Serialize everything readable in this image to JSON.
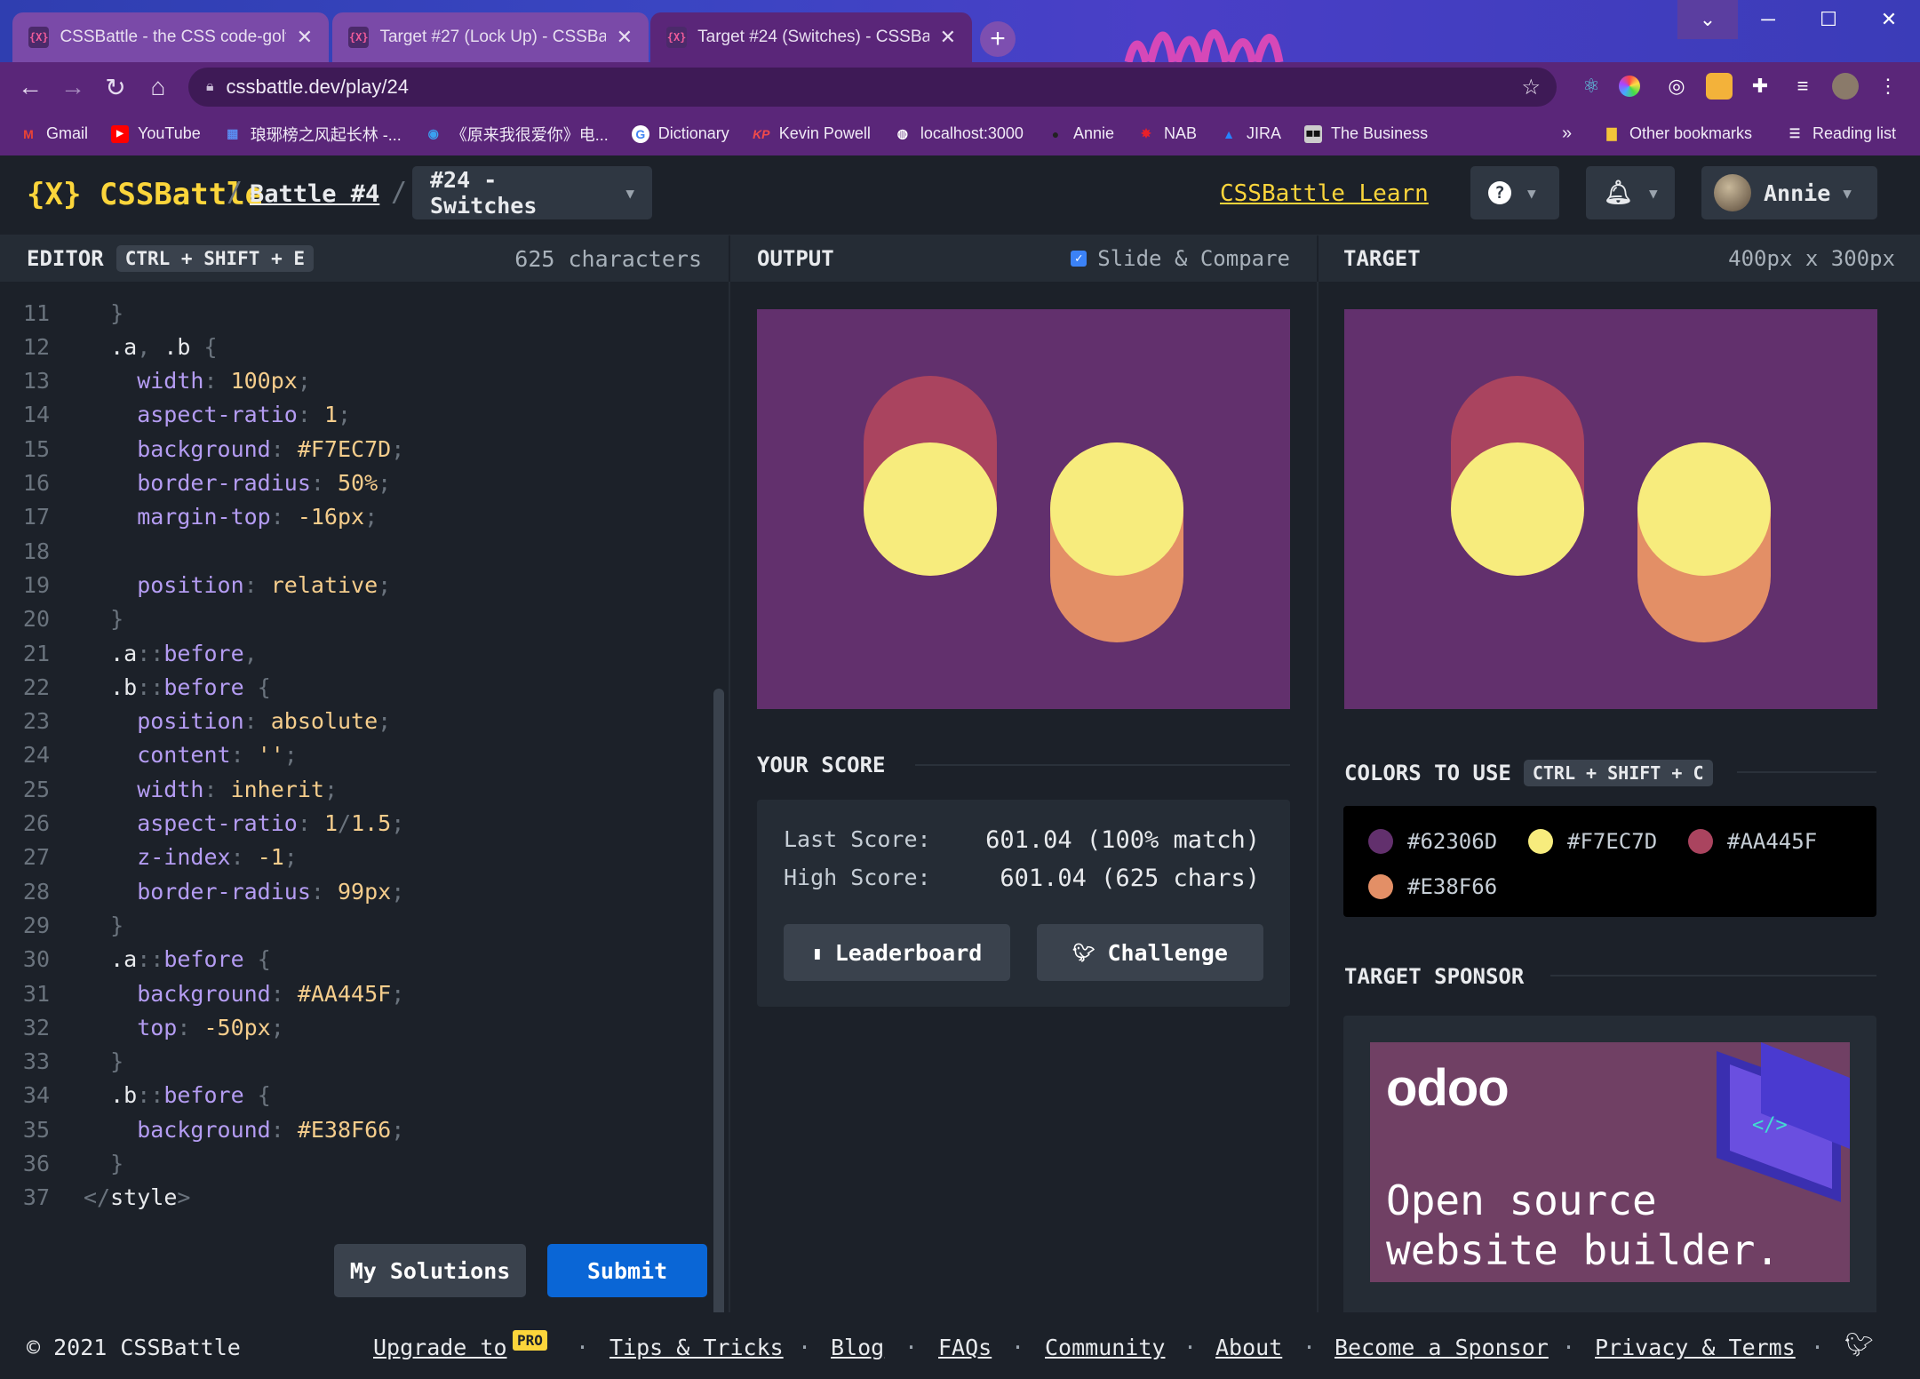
{
  "browser": {
    "tabs": [
      {
        "label": "CSSBattle - the CSS code-golfing",
        "favicon": "{X}"
      },
      {
        "label": "Target #27 (Lock Up) - CSSBattle",
        "favicon": "{X}"
      },
      {
        "label": "Target #24 (Switches) - CSSBattle",
        "favicon": "{X}"
      }
    ],
    "url": "cssbattle.dev/play/24",
    "bookmarks": [
      "Gmail",
      "YouTube",
      "琅琊榜之风起长林 -...",
      "《原来我很爱你》电...",
      "Dictionary",
      "Kevin Powell",
      "localhost:3000",
      "Annie",
      "NAB",
      "JIRA",
      "The Business"
    ],
    "bookmarks_overflow": "»",
    "other_bookmarks": "Other bookmarks",
    "reading_list": "Reading list"
  },
  "header": {
    "logo": "{X} CSSBattle",
    "battle": "Battle #4",
    "separator": "/",
    "target": "#24 - Switches",
    "learn": "CSSBattle Learn",
    "user": "Annie"
  },
  "editor": {
    "title": "EDITOR",
    "shortcut": "CTRL + SHIFT + E",
    "characters": "625 characters",
    "lines": [
      {
        "n": "11",
        "t": [
          [
            "punc",
            "  }"
          ]
        ]
      },
      {
        "n": "12",
        "t": [
          [
            "sel",
            "  .a"
          ],
          [
            "punc",
            ", "
          ],
          [
            "sel",
            ".b "
          ],
          [
            "punc",
            "{"
          ]
        ]
      },
      {
        "n": "13",
        "t": [
          [
            "prop",
            "    width"
          ],
          [
            "punc",
            ": "
          ],
          [
            "val",
            "100px"
          ],
          [
            "punc",
            ";"
          ]
        ]
      },
      {
        "n": "14",
        "t": [
          [
            "prop",
            "    aspect-ratio"
          ],
          [
            "punc",
            ": "
          ],
          [
            "val",
            "1"
          ],
          [
            "punc",
            ";"
          ]
        ]
      },
      {
        "n": "15",
        "t": [
          [
            "prop",
            "    background"
          ],
          [
            "punc",
            ": "
          ],
          [
            "val",
            "#F7EC7D"
          ],
          [
            "punc",
            ";"
          ]
        ]
      },
      {
        "n": "16",
        "t": [
          [
            "prop",
            "    border-radius"
          ],
          [
            "punc",
            ": "
          ],
          [
            "val",
            "50%"
          ],
          [
            "punc",
            ";"
          ]
        ]
      },
      {
        "n": "17",
        "t": [
          [
            "prop",
            "    margin-top"
          ],
          [
            "punc",
            ": "
          ],
          [
            "val",
            "-16px"
          ],
          [
            "punc",
            ";"
          ]
        ]
      },
      {
        "n": "18",
        "t": []
      },
      {
        "n": "19",
        "t": [
          [
            "prop",
            "    position"
          ],
          [
            "punc",
            ": "
          ],
          [
            "val",
            "relative"
          ],
          [
            "punc",
            ";"
          ]
        ]
      },
      {
        "n": "20",
        "t": [
          [
            "punc",
            "  }"
          ]
        ]
      },
      {
        "n": "21",
        "t": [
          [
            "sel",
            "  .a"
          ],
          [
            "punc",
            "::"
          ],
          [
            "prop",
            "before"
          ],
          [
            "punc",
            ","
          ]
        ]
      },
      {
        "n": "22",
        "t": [
          [
            "sel",
            "  .b"
          ],
          [
            "punc",
            "::"
          ],
          [
            "prop",
            "before "
          ],
          [
            "punc",
            "{"
          ]
        ]
      },
      {
        "n": "23",
        "t": [
          [
            "prop",
            "    position"
          ],
          [
            "punc",
            ": "
          ],
          [
            "val",
            "absolute"
          ],
          [
            "punc",
            ";"
          ]
        ]
      },
      {
        "n": "24",
        "t": [
          [
            "prop",
            "    content"
          ],
          [
            "punc",
            ": "
          ],
          [
            "val",
            "''"
          ],
          [
            "punc",
            ";"
          ]
        ]
      },
      {
        "n": "25",
        "t": [
          [
            "prop",
            "    width"
          ],
          [
            "punc",
            ": "
          ],
          [
            "val",
            "inherit"
          ],
          [
            "punc",
            ";"
          ]
        ]
      },
      {
        "n": "26",
        "t": [
          [
            "prop",
            "    aspect-ratio"
          ],
          [
            "punc",
            ": "
          ],
          [
            "val",
            "1"
          ],
          [
            "punc",
            "/"
          ],
          [
            "val",
            "1.5"
          ],
          [
            "punc",
            ";"
          ]
        ]
      },
      {
        "n": "27",
        "t": [
          [
            "prop",
            "    z-index"
          ],
          [
            "punc",
            ": "
          ],
          [
            "val",
            "-1"
          ],
          [
            "punc",
            ";"
          ]
        ]
      },
      {
        "n": "28",
        "t": [
          [
            "prop",
            "    border-radius"
          ],
          [
            "punc",
            ": "
          ],
          [
            "val",
            "99px"
          ],
          [
            "punc",
            ";"
          ]
        ]
      },
      {
        "n": "29",
        "t": [
          [
            "punc",
            "  }"
          ]
        ]
      },
      {
        "n": "30",
        "t": [
          [
            "sel",
            "  .a"
          ],
          [
            "punc",
            "::"
          ],
          [
            "prop",
            "before "
          ],
          [
            "punc",
            "{"
          ]
        ]
      },
      {
        "n": "31",
        "t": [
          [
            "prop",
            "    background"
          ],
          [
            "punc",
            ": "
          ],
          [
            "val",
            "#AA445F"
          ],
          [
            "punc",
            ";"
          ]
        ]
      },
      {
        "n": "32",
        "t": [
          [
            "prop",
            "    top"
          ],
          [
            "punc",
            ": "
          ],
          [
            "val",
            "-50px"
          ],
          [
            "punc",
            ";"
          ]
        ]
      },
      {
        "n": "33",
        "t": [
          [
            "punc",
            "  }"
          ]
        ]
      },
      {
        "n": "34",
        "t": [
          [
            "sel",
            "  .b"
          ],
          [
            "punc",
            "::"
          ],
          [
            "prop",
            "before "
          ],
          [
            "punc",
            "{"
          ]
        ]
      },
      {
        "n": "35",
        "t": [
          [
            "prop",
            "    background"
          ],
          [
            "punc",
            ": "
          ],
          [
            "val",
            "#E38F66"
          ],
          [
            "punc",
            ";"
          ]
        ]
      },
      {
        "n": "36",
        "t": [
          [
            "punc",
            "  }"
          ]
        ]
      },
      {
        "n": "37",
        "t": [
          [
            "punc",
            "</"
          ],
          [
            "sel",
            "style"
          ],
          [
            "punc",
            ">"
          ]
        ]
      }
    ],
    "my_solutions": "My Solutions",
    "submit": "Submit"
  },
  "output": {
    "title": "OUTPUT",
    "slide_compare": "Slide & Compare",
    "slide_checked": true
  },
  "target": {
    "title": "TARGET",
    "size": "400px x 300px"
  },
  "score": {
    "title": "YOUR SCORE",
    "last_label": "Last Score:",
    "last_value": "601.04 (100% match)",
    "high_label": "High Score:",
    "high_value": "601.04 (625 chars)",
    "leaderboard": "Leaderboard",
    "challenge": "Challenge"
  },
  "colors": {
    "title": "COLORS TO USE",
    "shortcut": "CTRL + SHIFT + C",
    "swatches": [
      {
        "hex": "#62306D",
        "label": "#62306D"
      },
      {
        "hex": "#F7EC7D",
        "label": "#F7EC7D"
      },
      {
        "hex": "#AA445F",
        "label": "#AA445F"
      },
      {
        "hex": "#E38F66",
        "label": "#E38F66"
      }
    ]
  },
  "sponsor": {
    "title": "TARGET SPONSOR",
    "logo": "odoo",
    "tagline_1": "Open source",
    "tagline_2": "website builder."
  },
  "footer": {
    "copyright": "© 2021 CSSBattle",
    "upgrade": "Upgrade to",
    "pro": "PRO",
    "links": [
      "Tips & Tricks",
      "Blog",
      "FAQs",
      "Community",
      "About",
      "Become a Sponsor",
      "Privacy & Terms"
    ],
    "separator": "·"
  },
  "theme": {
    "accent": "#fbd53b",
    "submit": "#0a66d6",
    "brand_purple": "#5a2679"
  }
}
